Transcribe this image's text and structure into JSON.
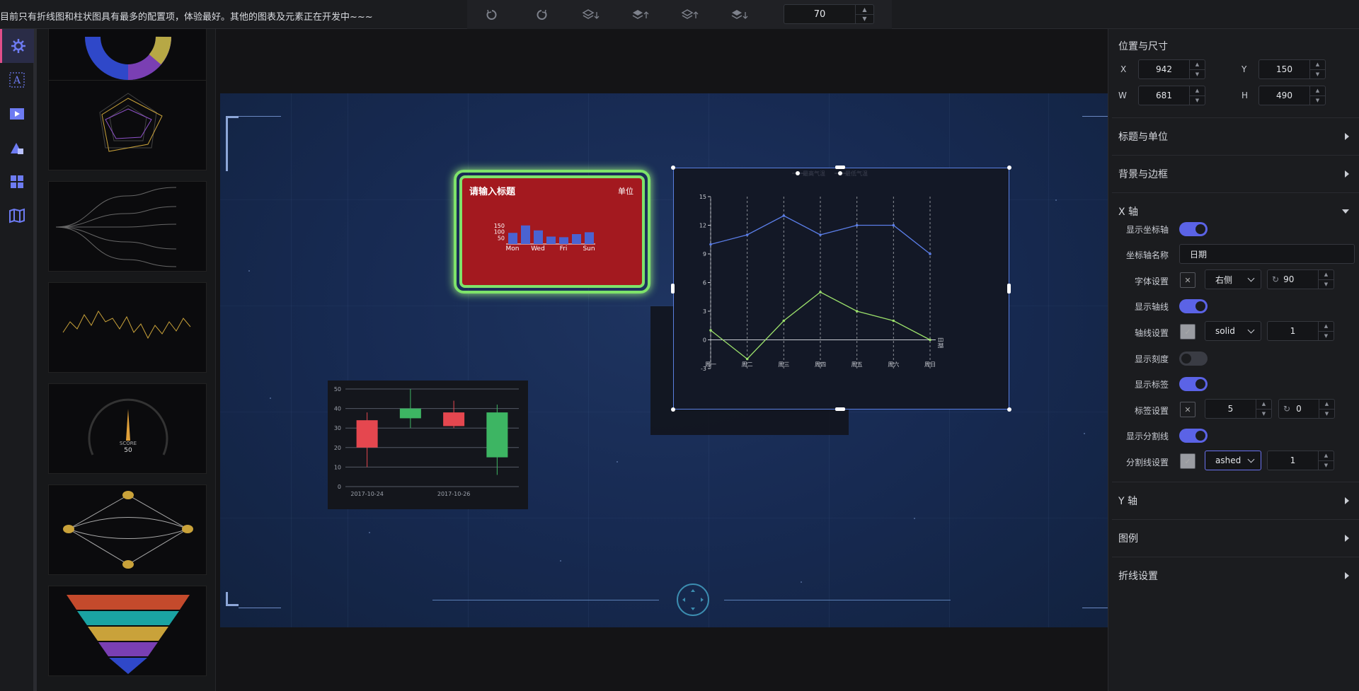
{
  "topbar": {
    "notice": "目前只有折线图和柱状图具有最多的配置项，体验最好。其他的图表及元素正在开发中~~~",
    "tools": [
      "undo-icon",
      "redo-icon",
      "layer-down-icon",
      "layer-up-icon",
      "layer-top-icon",
      "layer-bottom-icon"
    ],
    "zoom_value": "70"
  },
  "iconbar": [
    "chart-settings-icon",
    "text-icon",
    "media-icon",
    "shape-icon",
    "grid-icon",
    "map-icon"
  ],
  "canvas": {
    "red_card": {
      "title": "请输入标题",
      "unit": "单位",
      "y_ticks": [
        "150",
        "100",
        "50"
      ],
      "x_ticks": [
        "Mon",
        "Wed",
        "Fri",
        "Sun"
      ],
      "values": [
        90,
        150,
        110,
        60,
        55,
        80,
        95
      ]
    },
    "line_chart": {
      "legend": [
        "最高气温",
        "最低气温"
      ],
      "y_ticks": [
        "15",
        "12",
        "9",
        "6",
        "3",
        "0",
        "-3"
      ],
      "x_ticks": [
        "周一",
        "周二",
        "周三",
        "周四",
        "周五",
        "周六",
        "周日"
      ],
      "axis_name": "日期",
      "series": [
        {
          "name": "最高气温",
          "color": "#5b7ee8",
          "values": [
            10,
            11,
            13,
            11,
            12,
            12,
            9
          ]
        },
        {
          "name": "最低气温",
          "color": "#9be06b",
          "values": [
            1,
            -2,
            2,
            5,
            3,
            2,
            0
          ]
        }
      ]
    },
    "gauge": {
      "value": "50"
    },
    "candle": {
      "y_ticks": [
        "50",
        "40",
        "30",
        "20",
        "10",
        "0"
      ],
      "x_ticks": [
        "2017-10-24",
        "2017-10-26"
      ],
      "candles": [
        {
          "open": 20,
          "close": 34,
          "low": 10,
          "high": 38,
          "up": false
        },
        {
          "open": 35,
          "close": 40,
          "low": 30,
          "high": 50,
          "up": true
        },
        {
          "open": 38,
          "close": 31,
          "low": 30,
          "high": 44,
          "up": false
        },
        {
          "open": 15,
          "close": 38,
          "low": 6,
          "high": 42,
          "up": true
        }
      ]
    }
  },
  "panel": {
    "pos_title": "位置与尺寸",
    "x_label": "X",
    "x_value": "942",
    "y_label": "Y",
    "y_value": "150",
    "w_label": "W",
    "w_value": "681",
    "h_label": "H",
    "h_value": "490",
    "sections": {
      "title_unit": "标题与单位",
      "bg_border": "背景与边框",
      "x_axis": "X 轴",
      "y_axis": "Y 轴",
      "legend": "图例",
      "line_settings": "折线设置"
    },
    "x_axis": {
      "show_axis": "显示坐标轴",
      "axis_name_label": "坐标轴名称",
      "axis_name_value": "日期",
      "font_label": "字体设置",
      "font_pos": "右侧",
      "font_rotate": "90",
      "show_axis_line": "显示轴线",
      "axis_line_label": "轴线设置",
      "axis_line_style": "solid",
      "axis_line_width": "1",
      "show_ticks": "显示刻度",
      "show_labels": "显示标签",
      "label_settings": "标签设置",
      "label_margin": "5",
      "label_rotate": "0",
      "show_split": "显示分割线",
      "split_settings": "分割线设置",
      "split_style": "ashed",
      "split_width": "1"
    }
  }
}
